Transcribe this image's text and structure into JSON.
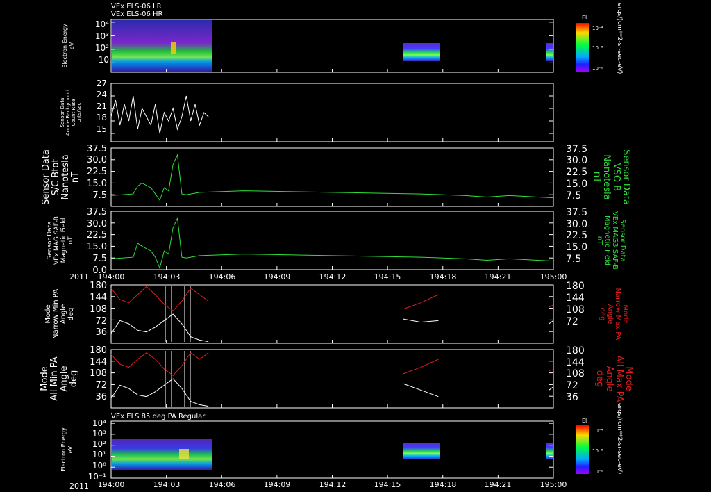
{
  "top_titles": [
    "VEx ELS-06 LR",
    "VEx ELS-06 HR"
  ],
  "bottom_title": "VEx ELS 85 deg PA Regular",
  "colorbar": {
    "label": "El",
    "ticks": [
      "10⁻⁴",
      "10⁻⁶",
      "10⁻⁸"
    ],
    "unit_label": "ergs/(cm**2-sr-sec-eV)"
  },
  "time_axis": {
    "year_label": "2011",
    "ticks": [
      "194:00",
      "194:03",
      "194:06",
      "194:09",
      "194:12",
      "194:15",
      "194:18",
      "194:21",
      "195:00"
    ]
  },
  "colors": {
    "white_trace": "#ffffff",
    "green_trace": "#2fe03a",
    "red_trace": "#e01e1e",
    "frame": "#ffffff"
  },
  "chart_data": [
    {
      "type": "heatmap",
      "panel": "electron-energy-lr-hr",
      "ylabel": [
        "Electron Energy",
        "eV"
      ],
      "yscale": "log",
      "yticks": [
        "10",
        "10²",
        "10³",
        "10⁴"
      ],
      "ytick_values": [
        1,
        2,
        3,
        4
      ],
      "ylim": [
        0.3,
        4.2
      ],
      "xlim": [
        0,
        1
      ],
      "blocks": [
        {
          "x0": 0.0,
          "x1": 0.228,
          "ymin": 0.3,
          "ymax": 4.2
        },
        {
          "x0": 0.655,
          "x1": 0.738,
          "ymin": 0.9,
          "ymax": 2.6
        },
        {
          "x0": 0.984,
          "x1": 1.0,
          "ymin": 0.9,
          "ymax": 2.4
        }
      ]
    },
    {
      "type": "line",
      "panel": "anode-background",
      "ylabel": [
        "Sensor Data",
        "Anode Background",
        "Count Rate",
        "cnts/sec"
      ],
      "yticks": [
        "15",
        "18",
        "21",
        "24",
        "27"
      ],
      "ytick_values": [
        15,
        18,
        21,
        24,
        27
      ],
      "ylim": [
        13,
        27
      ],
      "series": [
        {
          "color": "white",
          "x": [
            0.0,
            0.01,
            0.02,
            0.03,
            0.04,
            0.05,
            0.06,
            0.07,
            0.08,
            0.09,
            0.1,
            0.11,
            0.12,
            0.13,
            0.14,
            0.15,
            0.16,
            0.17,
            0.18,
            0.19,
            0.2,
            0.21,
            0.22
          ],
          "y": [
            19,
            23,
            17,
            22,
            18,
            24,
            16,
            21,
            19,
            17,
            22,
            15,
            20,
            18,
            21,
            16,
            19,
            24,
            18,
            22,
            17,
            20,
            19
          ]
        }
      ]
    },
    {
      "type": "line",
      "panel": "sc-btot",
      "ylabel": [
        "Sensor Data",
        "S/C Btot",
        "Nanotesla",
        "nT"
      ],
      "right_label": [
        "Sensor Data",
        "VSO B",
        "Nanotesla",
        "nT"
      ],
      "yticks": [
        "7.5",
        "15.0",
        "22.5",
        "30.0",
        "37.5"
      ],
      "ytick_values": [
        7.5,
        15.0,
        22.5,
        30.0,
        37.5
      ],
      "ylim": [
        0,
        37.5
      ],
      "series": [
        {
          "color": "green",
          "x": [
            0.0,
            0.05,
            0.06,
            0.07,
            0.09,
            0.1,
            0.11,
            0.12,
            0.13,
            0.14,
            0.15,
            0.16,
            0.17,
            0.2,
            0.3,
            0.4,
            0.5,
            0.6,
            0.7,
            0.8,
            0.85,
            0.9,
            1.0
          ],
          "y": [
            7.0,
            8.0,
            13.0,
            15.0,
            12.0,
            8.0,
            4.0,
            12.0,
            10.0,
            27.0,
            33.0,
            8.0,
            7.5,
            9.0,
            10.0,
            9.5,
            9.0,
            8.5,
            8.0,
            7.0,
            6.0,
            7.0,
            5.5
          ]
        }
      ]
    },
    {
      "type": "line",
      "panel": "mag-field",
      "ylabel": [
        "Sensor Data",
        "VEx MAG SAF-B",
        "Magnetic Field",
        "nT"
      ],
      "right_label": [
        "Sensor Data",
        "VEx MAG3 SAF-B",
        "Magnetic Field",
        "nT"
      ],
      "yticks": [
        "0.0",
        "7.5",
        "15.0",
        "22.5",
        "30.0",
        "37.5"
      ],
      "ytick_values": [
        0.0,
        7.5,
        15.0,
        22.5,
        30.0,
        37.5
      ],
      "ylim": [
        0,
        37.5
      ],
      "series": [
        {
          "color": "green",
          "x": [
            0.0,
            0.05,
            0.06,
            0.07,
            0.09,
            0.1,
            0.11,
            0.12,
            0.13,
            0.14,
            0.15,
            0.16,
            0.17,
            0.2,
            0.3,
            0.4,
            0.5,
            0.6,
            0.7,
            0.8,
            0.85,
            0.9,
            1.0
          ],
          "y": [
            7.0,
            8.0,
            17.0,
            15.0,
            12.0,
            8.0,
            1.0,
            12.0,
            10.0,
            27.0,
            33.0,
            8.0,
            7.5,
            9.0,
            10.0,
            9.5,
            9.0,
            8.5,
            8.0,
            7.0,
            6.0,
            7.0,
            5.5
          ]
        }
      ]
    },
    {
      "type": "line",
      "panel": "narrow-pa",
      "ylabel": [
        "Mode",
        "Narrow Min PA",
        "Angle",
        "deg"
      ],
      "right_label": [
        "Mode",
        "Narrow Max PA",
        "Angle",
        "deg"
      ],
      "yticks": [
        "36",
        "72",
        "108",
        "144",
        "180"
      ],
      "ytick_values": [
        36,
        72,
        108,
        144,
        180
      ],
      "ylim": [
        0,
        180
      ],
      "series": [
        {
          "color": "white",
          "x": [
            0.0,
            0.02,
            0.04,
            0.06,
            0.08,
            0.1,
            0.12,
            0.14,
            0.16,
            0.18,
            0.2,
            0.22,
            0.66,
            0.7,
            0.74,
            0.99,
            1.0
          ],
          "y": [
            30,
            70,
            60,
            40,
            35,
            50,
            70,
            90,
            60,
            20,
            10,
            5,
            75,
            65,
            70,
            60,
            70
          ]
        },
        {
          "color": "red",
          "x": [
            0.0,
            0.02,
            0.04,
            0.06,
            0.08,
            0.1,
            0.12,
            0.14,
            0.16,
            0.18,
            0.2,
            0.22,
            0.66,
            0.7,
            0.74,
            0.99,
            1.0
          ],
          "y": [
            170,
            135,
            125,
            150,
            175,
            150,
            120,
            100,
            130,
            170,
            150,
            130,
            105,
            125,
            150,
            112,
            118
          ]
        }
      ]
    },
    {
      "type": "line",
      "panel": "all-pa",
      "ylabel": [
        "Mode",
        "All Min PA",
        "Angle",
        "deg"
      ],
      "right_label": [
        "Mode",
        "All Max PA",
        "Angle",
        "deg"
      ],
      "yticks": [
        "36",
        "72",
        "108",
        "144",
        "180"
      ],
      "ytick_values": [
        36,
        72,
        108,
        144,
        180
      ],
      "ylim": [
        0,
        180
      ],
      "series": [
        {
          "color": "white",
          "x": [
            0.0,
            0.02,
            0.04,
            0.06,
            0.08,
            0.1,
            0.12,
            0.14,
            0.16,
            0.18,
            0.2,
            0.22,
            0.66,
            0.7,
            0.74,
            0.99,
            1.0
          ],
          "y": [
            30,
            70,
            60,
            40,
            35,
            50,
            70,
            90,
            60,
            20,
            10,
            5,
            75,
            55,
            35,
            55,
            65
          ]
        },
        {
          "color": "red",
          "x": [
            0.0,
            0.02,
            0.04,
            0.06,
            0.08,
            0.1,
            0.12,
            0.14,
            0.16,
            0.18,
            0.2,
            0.22,
            0.66,
            0.7,
            0.74,
            0.99,
            1.0
          ],
          "y": [
            165,
            135,
            125,
            150,
            170,
            150,
            120,
            100,
            130,
            170,
            150,
            170,
            105,
            125,
            150,
            115,
            118
          ]
        }
      ]
    },
    {
      "type": "heatmap",
      "panel": "electron-energy-85deg",
      "ylabel": [
        "Electron Energy",
        "eV"
      ],
      "yscale": "log",
      "yticks": [
        "10⁻¹",
        "10⁰",
        "10¹",
        "10²",
        "10³",
        "10⁴"
      ],
      "ytick_values": [
        -1,
        0,
        1,
        2,
        3,
        4
      ],
      "ylim": [
        -1,
        4.2
      ],
      "xlim": [
        0,
        1
      ],
      "blocks": [
        {
          "x0": 0.0,
          "x1": 0.228,
          "ymin": 0.0,
          "ymax": 2.5
        },
        {
          "x0": 0.655,
          "x1": 0.738,
          "ymin": 0.3,
          "ymax": 2.0
        },
        {
          "x0": 0.984,
          "x1": 1.0,
          "ymin": 0.3,
          "ymax": 2.0
        }
      ]
    }
  ]
}
